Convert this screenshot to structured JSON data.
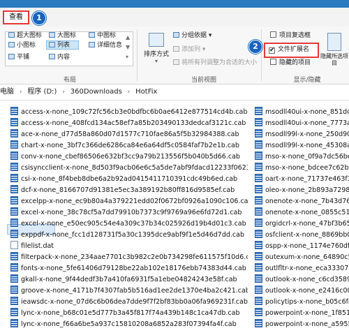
{
  "tabs": {
    "view": "查看"
  },
  "badges": {
    "one": "1",
    "two": "2"
  },
  "ribbon": {
    "layout": {
      "items": [
        "超大图标",
        "大图标",
        "中图标",
        "小图标",
        "列表",
        "详细信息",
        "平铺",
        "内容"
      ],
      "group_label": "布局"
    },
    "current_view": {
      "sort_label": "排序方式",
      "group_by": "分组依据",
      "add_column": "添加列",
      "size_columns": "将所有列调整为合适的大小",
      "group_label": "当前视图"
    },
    "show_hide": {
      "item_checkbox": "项目复选框",
      "extensions": "文件扩展名",
      "hidden_items": "隐藏的项目",
      "hide_selected": "隐藏所选项目",
      "group_label": "显示/隐藏"
    }
  },
  "address": {
    "crumbs": [
      "电脑",
      "程序 (D:)",
      "360Downloads",
      "HotFix"
    ]
  },
  "files_left": [
    "access-x-none_109c72fc56cb3e0bdfbc6b0ae6412e877514cd4b.cab",
    "access-x-none_408fcd134ac58ef7a85b203490133dedcaf3121c.cab",
    "ace-x-none_d77d58a860d07d1577c710fae86a5f5b32984388.cab",
    "chart-x-none_3bf7c366de6286ca84e6a64df5c0584faf7b2e1b.cab",
    "conv-x-none_cbef86506e632bf3cc9a79b213556f5b040b5d66.cab",
    "csisyncclient-x-none_8d503f9acb06e6c5a5de7abf9fdacd12233f0623.cab",
    "csi-x-none_8f4beb8dbe6a2b92ad0415411710391cdc49b6ed.cab",
    "dcf-x-none_8166707d91381e5ec3a389192b80ff816d9585ef.cab",
    "excelpp-x-none_ec9b80a4a379221edd02f0672bf0926a1090c106.cab",
    "excel-x-none_38c78cf5a7dd79910b7373c9f9769a96e6fd72d1.cab",
    "excel-x-none_e50ec905c54e4a309c37b34c025926d19b4d01c3.cab",
    "exppdf-x-none_fcc1d128731f5a30c1395dce9abf9f1e5d46d7dd.cab",
    "filelist.dat",
    "filterpack-x-none_234aae7701c3b982c2e0b734298fe611575f10d6.cab",
    "fonts-x-none_5fe61406d79128be22ab102e18176ebb74383d44.cab",
    "gkall-x-none_9f44dedf3b7a410fa6931f5a1ebe04824243e58f.cab",
    "groove-x-none_4171b7f4307fab5b516ad1ee2de1370e4ba2c421.cab",
    "ieawsdc-x-none_07d6c6b06dea7dde9f7f2bf83bb0a06fa969231f.cab",
    "lync-x-none_b68c01e5d777b3a45f817f74a439b148c1ca47db.cab",
    "lync-x-none_f66a6be5a937c15810208a6852a283f07394fa4f.cab"
  ],
  "files_right": [
    "msodll40ui-x-none_851dc3",
    "msodll40ui-x-none_7773aa",
    "msodll99l-x-none_250d901",
    "msodll99l-x-none_45308a74",
    "mso-x-none_0f9a7dc56bea",
    "mso-x-none_bdcee7c62b0c",
    "oart-x-none_71737e463f3b",
    "oleo-x-none_2b893a72980",
    "onenote-x-none_7b43d766",
    "onenote-x-none_0855c51c9",
    "orgidcrl-x-none_47bf3b655",
    "osfclient-x-none_8869bb0a",
    "ospp-x-none_1174e760df7",
    "outexum-x-none_64890c55",
    "outlfltr-x-none_eca333075",
    "outlook-x-none_c6cd35899",
    "outlook-x-none_e2416c00e",
    "policytips-x-none_b05c6fc8",
    "powerpoint-x-none_1f8513",
    "powerpoint-x-none_a59553"
  ],
  "colors": {
    "accent": "#2b7bc0",
    "highlight": "#e53935",
    "badge": "#1565c0"
  }
}
